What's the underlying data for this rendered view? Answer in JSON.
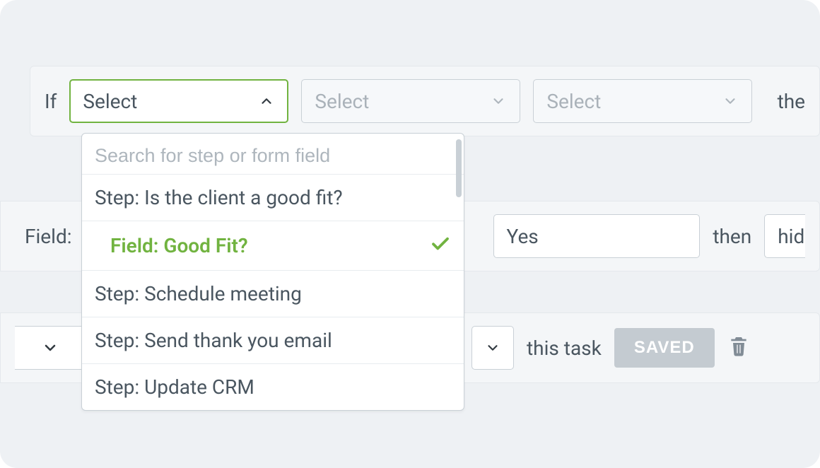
{
  "row1": {
    "if_label": "If",
    "select1": "Select",
    "select2": "Select",
    "select3": "Select",
    "then_label": "the"
  },
  "dropdown": {
    "search_placeholder": "Search for step or form field",
    "options": [
      {
        "label": "Step: Is the client a good fit?",
        "indented": false,
        "selected": false
      },
      {
        "label": "Field: Good Fit?",
        "indented": true,
        "selected": true
      },
      {
        "label": "Step: Schedule meeting",
        "indented": false,
        "selected": false
      },
      {
        "label": "Step: Send thank you email",
        "indented": false,
        "selected": false
      },
      {
        "label": "Step: Update CRM",
        "indented": false,
        "selected": false
      }
    ]
  },
  "row2": {
    "field_label": "Field:",
    "value": "Yes",
    "then_label": "then",
    "hide_label": "hid"
  },
  "row3": {
    "this_task_label": "this task",
    "saved_label": "SAVED"
  }
}
